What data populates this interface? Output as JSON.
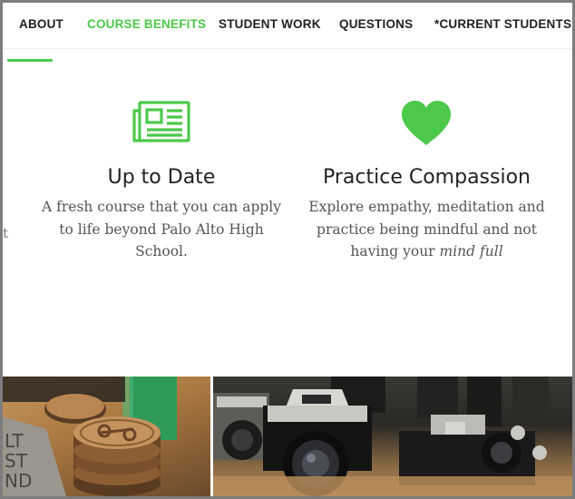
{
  "nav": {
    "items": [
      {
        "label": "ABOUT",
        "active": false
      },
      {
        "label": "COURSE BENEFITS",
        "active": true
      },
      {
        "label": "STUDENT WORK",
        "active": false
      },
      {
        "label": "QUESTIONS",
        "active": false
      },
      {
        "label": "*CURRENT STUDENTS",
        "active": false
      }
    ]
  },
  "features": [
    {
      "icon": "newspaper-icon",
      "title": "Up to Date",
      "description": "A fresh course that you can apply to life beyond Palo Alto High School."
    },
    {
      "icon": "heart-icon",
      "title": "Practice Compassion",
      "description_start": "Explore empathy, meditation and practice being mindful and not having your ",
      "description_emphasis": "mind full"
    }
  ],
  "cutoff_text": "t",
  "colors": {
    "accent": "#4cc94a",
    "text": "#222222",
    "body_text": "#555555"
  }
}
